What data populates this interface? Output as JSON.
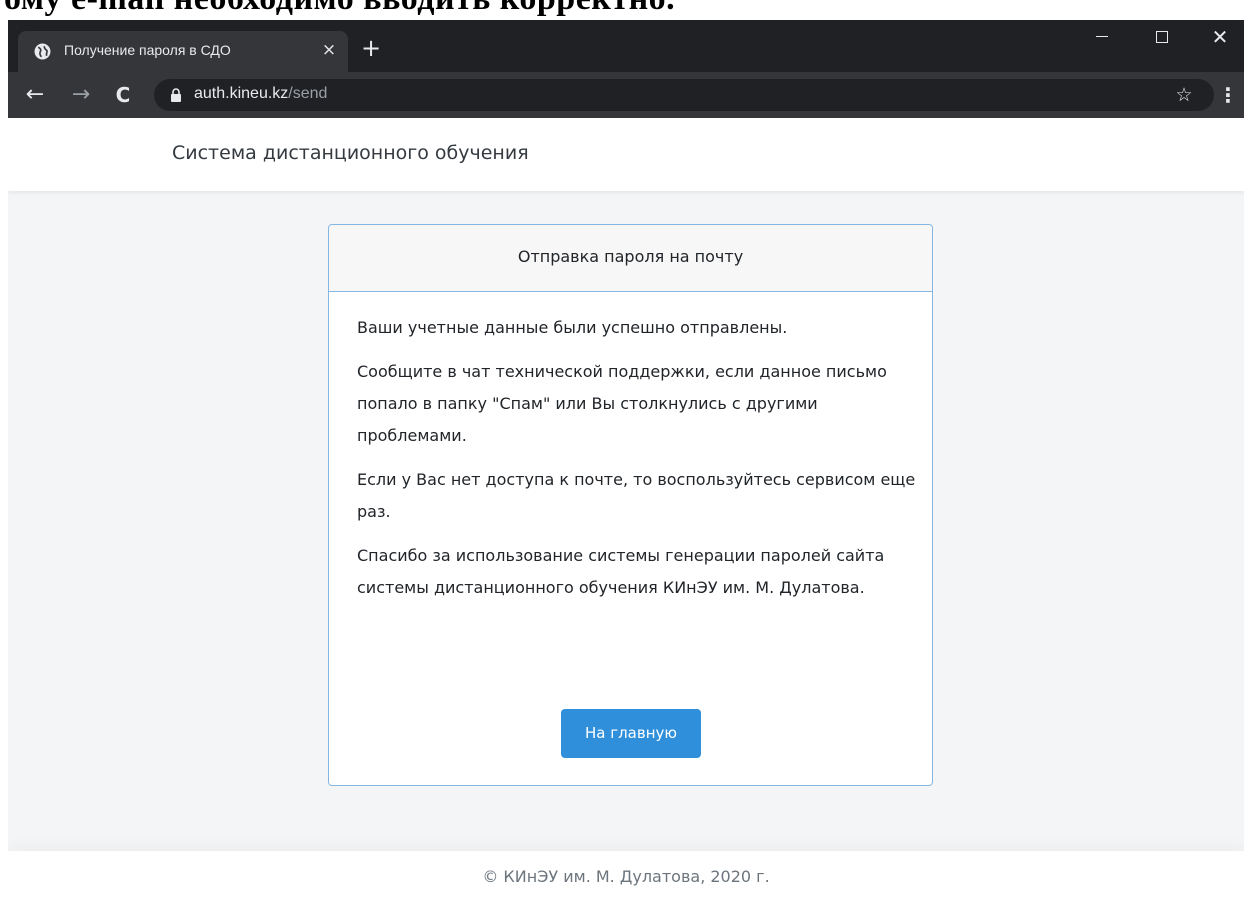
{
  "document": {
    "top_text": "ому e-mail необходимо вводить корректно."
  },
  "browser": {
    "tab": {
      "title": "Получение пароля в СДО",
      "close": "×",
      "favicon": "globe-icon"
    },
    "new_tab": "+",
    "window_controls": {
      "close": "✕"
    },
    "url": {
      "host": "auth.kineu.kz",
      "path": "/send"
    },
    "icons": {
      "back": "←",
      "forward": "→",
      "reload": "C",
      "star": "☆",
      "menu": "⋮"
    }
  },
  "header": {
    "brand": "Система дистанционного обучения"
  },
  "card": {
    "title": "Отправка пароля на почту",
    "paragraphs": [
      "Ваши учетные данные были успешно отправлены.",
      "Сообщите в чат технической поддержки, если данное письмо попало в папку \"Спам\" или Вы столкнулись с другими проблемами.",
      "Если у Вас нет доступа к почте, то воспользуйтесь сервисом еще раз.",
      "Спасибо за использование системы генерации паролей сайта системы дистанционного обучения КИнЭУ им. М. Дулатова."
    ],
    "button": "На главную"
  },
  "footer": {
    "text": "© КИнЭУ им. М. Дулатова, 2020 г."
  },
  "colors": {
    "accent": "#2f8fdb",
    "card_border": "#86b7e3",
    "browser_dark": "#202124"
  }
}
